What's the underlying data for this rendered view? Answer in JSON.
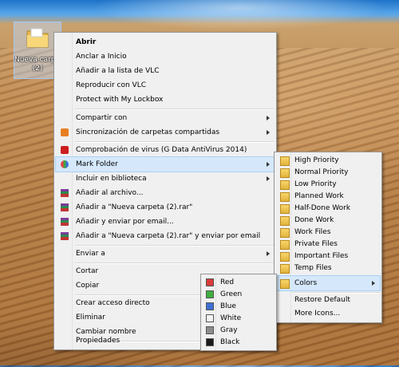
{
  "desktop": {
    "icon_label_line1": "Nueva carpeta",
    "icon_label_line2": "(2)"
  },
  "context_menu": {
    "items": [
      {
        "label": "Abrir",
        "bold": true,
        "icon": ""
      },
      {
        "label": "Anclar a Inicio",
        "icon": ""
      },
      {
        "label": "Añadir a la lista de VLC",
        "icon": ""
      },
      {
        "label": "Reproducir con VLC",
        "icon": ""
      },
      {
        "label": "Protect with My Lockbox",
        "icon": ""
      },
      {
        "label": "Compartir con",
        "submenu": true,
        "icon": ""
      },
      {
        "label": "Sincronización de carpetas compartidas",
        "submenu": true,
        "icon": "sync-icon"
      },
      {
        "label": "Comprobación de virus (G Data AntiVirus 2014)",
        "icon": "g-data-shield-icon"
      },
      {
        "label": "Mark Folder",
        "submenu": true,
        "highlighted": true,
        "icon": "mark-folder-icon"
      },
      {
        "label": "Incluir en biblioteca",
        "submenu": true,
        "icon": ""
      },
      {
        "label": "Añadir al archivo...",
        "icon": "winrar-icon"
      },
      {
        "label": "Añadir a \"Nueva carpeta (2).rar\"",
        "icon": "winrar-icon"
      },
      {
        "label": "Añadir y enviar por email...",
        "icon": "winrar-icon"
      },
      {
        "label": "Añadir a \"Nueva carpeta (2).rar\" y enviar por email",
        "icon": "winrar-icon"
      },
      {
        "label": "Enviar a",
        "submenu": true,
        "icon": ""
      },
      {
        "label": "Cortar",
        "icon": ""
      },
      {
        "label": "Copiar",
        "icon": ""
      },
      {
        "label": "Crear acceso directo",
        "icon": ""
      },
      {
        "label": "Eliminar",
        "icon": ""
      },
      {
        "label": "Cambiar nombre",
        "icon": ""
      },
      {
        "label": "Propiedades",
        "icon": ""
      }
    ]
  },
  "mark_folder_menu": {
    "items": [
      {
        "label": "High Priority",
        "icon": "high-priority-folder-icon"
      },
      {
        "label": "Normal Priority",
        "icon": "normal-priority-folder-icon"
      },
      {
        "label": "Low Priority",
        "icon": "low-priority-folder-icon"
      },
      {
        "label": "Planned Work",
        "icon": "planned-work-folder-icon"
      },
      {
        "label": "Half-Done Work",
        "icon": "half-done-work-folder-icon"
      },
      {
        "label": "Done Work",
        "icon": "done-work-folder-icon"
      },
      {
        "label": "Work Files",
        "icon": "work-files-folder-icon"
      },
      {
        "label": "Private Files",
        "icon": "private-files-folder-icon"
      },
      {
        "label": "Important Files",
        "icon": "important-files-folder-icon"
      },
      {
        "label": "Temp Files",
        "icon": "temp-files-folder-icon"
      },
      {
        "label": "Colors",
        "submenu": true,
        "highlighted": true,
        "icon": "colors-folder-icon"
      },
      {
        "label": "Restore Default",
        "icon": ""
      },
      {
        "label": "More Icons...",
        "icon": ""
      }
    ]
  },
  "colors_menu": {
    "items": [
      {
        "label": "Red",
        "color": "#d93a3a"
      },
      {
        "label": "Green",
        "color": "#3fae3f"
      },
      {
        "label": "Blue",
        "color": "#3e6fd6"
      },
      {
        "label": "White",
        "color": "#f4f4f4"
      },
      {
        "label": "Gray",
        "color": "#8c8c8c"
      },
      {
        "label": "Black",
        "color": "#1a1a1a"
      }
    ]
  },
  "colors": {
    "highlight": "#d5e8fb",
    "menu_bg": "#f0f0f0"
  }
}
